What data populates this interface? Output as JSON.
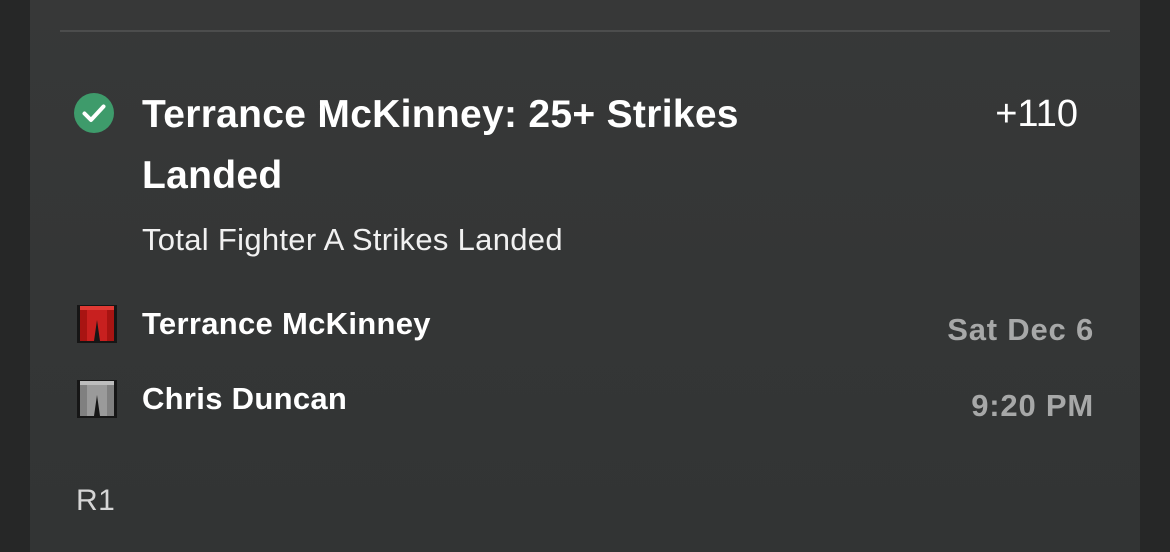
{
  "bet": {
    "status": "won",
    "title": "Terrance McKinney: 25+ Strikes Landed",
    "odds": "+110",
    "market": "Total Fighter A Strikes Landed"
  },
  "fighters": [
    {
      "name": "Terrance McKinney",
      "trunks_color": "#c8201f",
      "trunks_icon": "red-trunks-icon"
    },
    {
      "name": "Chris Duncan",
      "trunks_color": "#9a9a9a",
      "trunks_icon": "gray-trunks-icon"
    }
  ],
  "event": {
    "date": "Sat Dec 6",
    "time": "9:20 PM"
  },
  "round": "R1",
  "colors": {
    "success": "#3e9b6b",
    "background": "#262727",
    "card": "#363737",
    "muted_text": "#a7a8a8"
  }
}
